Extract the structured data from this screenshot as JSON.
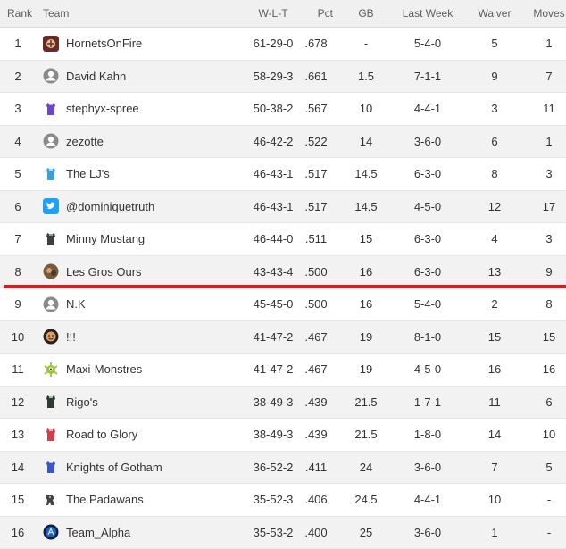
{
  "header": {
    "rank": "Rank",
    "team": "Team",
    "wlt": "W-L-T",
    "pct": "Pct",
    "gb": "GB",
    "last_week": "Last Week",
    "waiver": "Waiver",
    "moves": "Moves"
  },
  "colors": {
    "cutoff_line": "#e8141c",
    "row_alt": "#f2f2f2",
    "header_bg": "#f0f0f0"
  },
  "rows": [
    {
      "rank": "1",
      "team": "HornetsOnFire",
      "wlt": "61-29-0",
      "pct": ".678",
      "gb": "-",
      "last_week": "5-4-0",
      "waiver": "5",
      "moves": "1",
      "icon": "custom-logo-icon"
    },
    {
      "rank": "2",
      "team": "David Kahn",
      "wlt": "58-29-3",
      "pct": ".661",
      "gb": "1.5",
      "last_week": "7-1-1",
      "waiver": "9",
      "moves": "7",
      "icon": "default-user-icon"
    },
    {
      "rank": "3",
      "team": "stephyx-spree",
      "wlt": "50-38-2",
      "pct": ".567",
      "gb": "10",
      "last_week": "4-4-1",
      "waiver": "3",
      "moves": "11",
      "icon": "purple-jersey-icon"
    },
    {
      "rank": "4",
      "team": "zezotte",
      "wlt": "46-42-2",
      "pct": ".522",
      "gb": "14",
      "last_week": "3-6-0",
      "waiver": "6",
      "moves": "1",
      "icon": "default-user-icon"
    },
    {
      "rank": "5",
      "team": "The LJ's",
      "wlt": "46-43-1",
      "pct": ".517",
      "gb": "14.5",
      "last_week": "6-3-0",
      "waiver": "8",
      "moves": "3",
      "icon": "teal-jersey-icon"
    },
    {
      "rank": "6",
      "team": "@dominiquetruth",
      "wlt": "46-43-1",
      "pct": ".517",
      "gb": "14.5",
      "last_week": "4-5-0",
      "waiver": "12",
      "moves": "17",
      "icon": "twitter-bird-icon"
    },
    {
      "rank": "7",
      "team": "Minny Mustang",
      "wlt": "46-44-0",
      "pct": ".511",
      "gb": "15",
      "last_week": "6-3-0",
      "waiver": "4",
      "moves": "3",
      "icon": "dark-jersey-icon"
    },
    {
      "rank": "8",
      "team": "Les Gros Ours",
      "wlt": "43-43-4",
      "pct": ".500",
      "gb": "16",
      "last_week": "6-3-0",
      "waiver": "13",
      "moves": "9",
      "icon": "photo-avatar-icon"
    },
    {
      "rank": "9",
      "team": "N.K",
      "wlt": "45-45-0",
      "pct": ".500",
      "gb": "16",
      "last_week": "5-4-0",
      "waiver": "2",
      "moves": "8",
      "icon": "default-user-icon"
    },
    {
      "rank": "10",
      "team": "!!!",
      "wlt": "41-47-2",
      "pct": ".467",
      "gb": "19",
      "last_week": "8-1-0",
      "waiver": "15",
      "moves": "15",
      "icon": "face-avatar-icon"
    },
    {
      "rank": "11",
      "team": "Maxi-Monstres",
      "wlt": "41-47-2",
      "pct": ".467",
      "gb": "19",
      "last_week": "4-5-0",
      "waiver": "16",
      "moves": "16",
      "icon": "monster-avatar-icon"
    },
    {
      "rank": "12",
      "team": "Rigo's",
      "wlt": "38-49-3",
      "pct": ".439",
      "gb": "21.5",
      "last_week": "1-7-1",
      "waiver": "11",
      "moves": "6",
      "icon": "green-jersey-icon"
    },
    {
      "rank": "13",
      "team": "Road to Glory",
      "wlt": "38-49-3",
      "pct": ".439",
      "gb": "21.5",
      "last_week": "1-8-0",
      "waiver": "14",
      "moves": "10",
      "icon": "red-jersey-icon"
    },
    {
      "rank": "14",
      "team": "Knights of Gotham",
      "wlt": "36-52-2",
      "pct": ".411",
      "gb": "24",
      "last_week": "3-6-0",
      "waiver": "7",
      "moves": "5",
      "icon": "blue-jersey-icon"
    },
    {
      "rank": "15",
      "team": "The Padawans",
      "wlt": "35-52-3",
      "pct": ".406",
      "gb": "24.5",
      "last_week": "4-4-1",
      "waiver": "10",
      "moves": "-",
      "icon": "mech-avatar-icon"
    },
    {
      "rank": "16",
      "team": "Team_Alpha",
      "wlt": "35-53-2",
      "pct": ".400",
      "gb": "25",
      "last_week": "3-6-0",
      "waiver": "1",
      "moves": "-",
      "icon": "alpha-logo-icon"
    }
  ]
}
